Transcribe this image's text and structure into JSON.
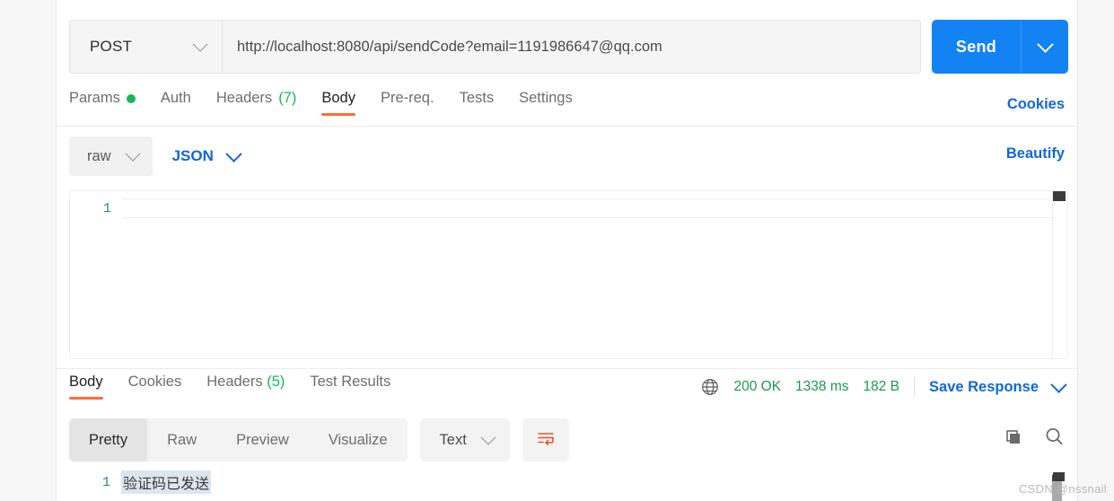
{
  "request": {
    "method": "POST",
    "url": "http://localhost:8080/api/sendCode?email=1191986647@qq.com",
    "send_label": "Send",
    "tabs": [
      {
        "label": "Params",
        "badge": "",
        "has_dot": true,
        "active": false
      },
      {
        "label": "Auth",
        "badge": "",
        "has_dot": false,
        "active": false
      },
      {
        "label": "Headers",
        "badge": "(7)",
        "has_dot": false,
        "active": false
      },
      {
        "label": "Body",
        "badge": "",
        "has_dot": false,
        "active": true
      },
      {
        "label": "Pre-req.",
        "badge": "",
        "has_dot": false,
        "active": false
      },
      {
        "label": "Tests",
        "badge": "",
        "has_dot": false,
        "active": false
      },
      {
        "label": "Settings",
        "badge": "",
        "has_dot": false,
        "active": false
      }
    ],
    "cookies_label": "Cookies",
    "body_mode": "raw",
    "body_format": "JSON",
    "beautify_label": "Beautify",
    "editor": {
      "line_numbers": [
        "1"
      ],
      "lines": [
        ""
      ]
    }
  },
  "response": {
    "tabs": [
      {
        "label": "Body",
        "badge": "",
        "active": true
      },
      {
        "label": "Cookies",
        "badge": "",
        "active": false
      },
      {
        "label": "Headers",
        "badge": "(5)",
        "active": false
      },
      {
        "label": "Test Results",
        "badge": "",
        "active": false
      }
    ],
    "status": {
      "code": "200 OK",
      "time": "1338 ms",
      "size": "182 B",
      "color": "#1a9b4a"
    },
    "save_response_label": "Save Response",
    "view_modes": [
      {
        "label": "Pretty",
        "active": true
      },
      {
        "label": "Raw",
        "active": false
      },
      {
        "label": "Preview",
        "active": false
      },
      {
        "label": "Visualize",
        "active": false
      }
    ],
    "content_type": "Text",
    "body": {
      "line_numbers": [
        "1"
      ],
      "lines": [
        "验证码已发送"
      ]
    }
  },
  "watermark": "CSDN @nssnail",
  "theme": {
    "accent_orange": "#ff6c37",
    "link_blue": "#1168d8",
    "send_blue": "#1382f3",
    "success_green": "#14ba56",
    "status_green": "#1a9b4a"
  }
}
